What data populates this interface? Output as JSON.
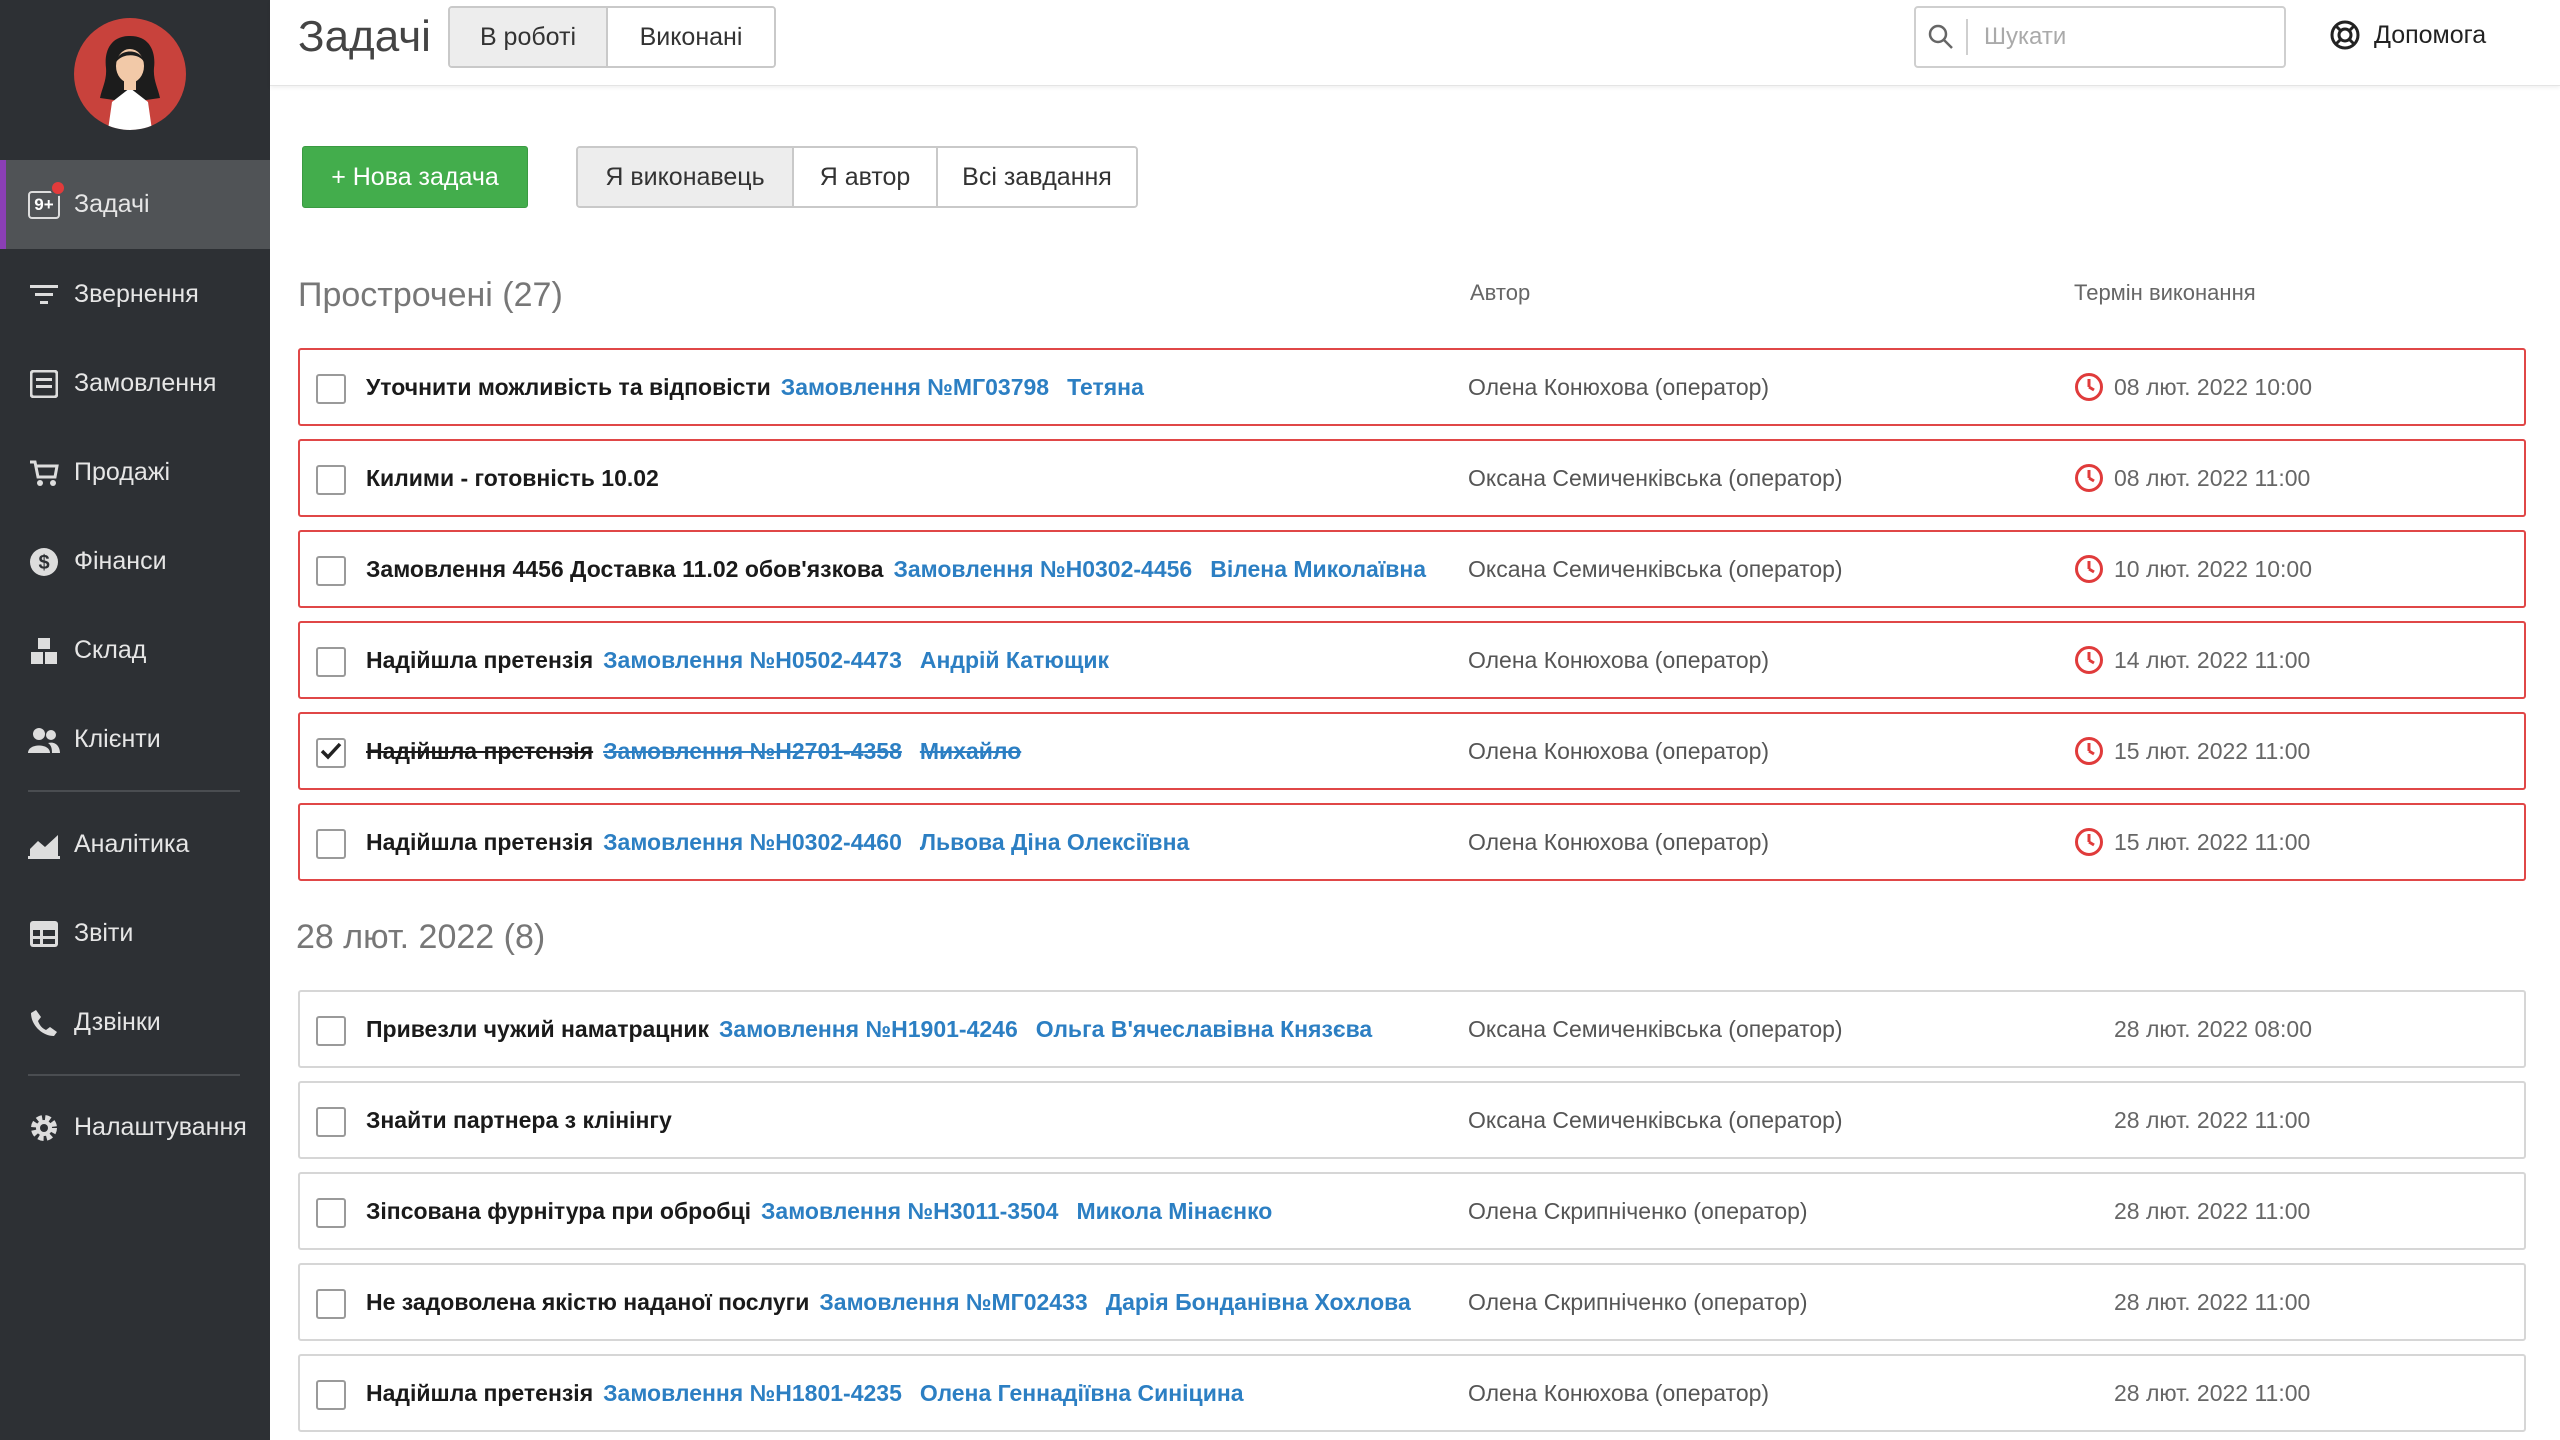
{
  "sidebar": {
    "items": [
      {
        "label": "Задачі",
        "icon": "tasks-badge-icon",
        "badge": "9+"
      },
      {
        "label": "Звернення",
        "icon": "filter-icon"
      },
      {
        "label": "Замовлення",
        "icon": "order-list-icon"
      },
      {
        "label": "Продажі",
        "icon": "cart-icon"
      },
      {
        "label": "Фінанси",
        "icon": "dollar-circle-icon"
      },
      {
        "label": "Склад",
        "icon": "boxes-icon"
      },
      {
        "label": "Клієнти",
        "icon": "users-icon"
      },
      {
        "label": "Аналітика",
        "icon": "chart-area-icon"
      },
      {
        "label": "Звіти",
        "icon": "table-icon"
      },
      {
        "label": "Дзвінки",
        "icon": "phone-icon"
      },
      {
        "label": "Налаштування",
        "icon": "gear-icon"
      }
    ]
  },
  "header": {
    "title": "Задачі",
    "tabs": [
      "В роботі",
      "Виконані"
    ],
    "search_placeholder": "Шукати",
    "help_label": "Допомога"
  },
  "toolbar": {
    "new_task_label": "+ Нова задача",
    "filters": [
      "Я виконавець",
      "Я автор",
      "Всі завдання"
    ]
  },
  "columns": {
    "author": "Автор",
    "due": "Термін виконання"
  },
  "overdue": {
    "title": "Прострочені (27)",
    "tasks": [
      {
        "title": "Уточнити можливість та відповісти",
        "order": "Замовлення №МГ03798",
        "client": "Тетяна",
        "author": "Олена Конюхова (оператор)",
        "due": "08 лют. 2022 10:00",
        "done": false
      },
      {
        "title": "Килими - готовність 10.02",
        "order": "",
        "client": "",
        "author": "Оксана Семиченківська (оператор)",
        "due": "08 лют. 2022 11:00",
        "done": false
      },
      {
        "title": "Замовлення 4456 Доставка 11.02 обов'язкова",
        "order": "Замовлення №Н0302-4456",
        "client": "Вілена Миколаївна",
        "author": "Оксана Семиченківська (оператор)",
        "due": "10 лют. 2022 10:00",
        "done": false
      },
      {
        "title": "Надійшла претензія",
        "order": "Замовлення №Н0502-4473",
        "client": "Андрій Катющик",
        "author": "Олена Конюхова (оператор)",
        "due": "14 лют. 2022 11:00",
        "done": false
      },
      {
        "title": "Надійшла претензія",
        "order": "Замовлення №Н2701-4358",
        "client": "Михайло",
        "author": "Олена Конюхова (оператор)",
        "due": "15 лют. 2022 11:00",
        "done": true
      },
      {
        "title": "Надійшла претензія",
        "order": "Замовлення №Н0302-4460",
        "client": "Львова Діна Олексіївна",
        "author": "Олена Конюхова (оператор)",
        "due": "15 лют. 2022 11:00",
        "done": false
      }
    ]
  },
  "date_group": {
    "title": "28 лют. 2022 (8)",
    "tasks": [
      {
        "title": "Привезли чужий наматрацник",
        "order": "Замовлення №Н1901-4246",
        "client": "Ольга В'ячеславівна Князєва",
        "author": "Оксана Семиченківська (оператор)",
        "due": "28 лют. 2022 08:00",
        "done": false
      },
      {
        "title": "Знайти партнера з клінінгу",
        "order": "",
        "client": "",
        "author": "Оксана Семиченківська (оператор)",
        "due": "28 лют. 2022 11:00",
        "done": false
      },
      {
        "title": "Зіпсована фурнітура при обробці",
        "order": "Замовлення №Н3011-3504",
        "client": "Микола Мінаєнко",
        "author": "Олена Скрипніченко (оператор)",
        "due": "28 лют. 2022 11:00",
        "done": false
      },
      {
        "title": "Не задоволена якістю наданої послуги",
        "order": "Замовлення №МГ02433",
        "client": "Дарія Бонданівна Хохлова",
        "author": "Олена Скрипніченко (оператор)",
        "due": "28 лют. 2022 11:00",
        "done": false
      },
      {
        "title": "Надійшла претензія",
        "order": "Замовлення №Н1801-4235",
        "client": "Олена Геннадіївна Синіцина",
        "author": "Олена Конюхова (оператор)",
        "due": "28 лют. 2022 11:00",
        "done": false
      }
    ]
  },
  "colors": {
    "sidebar_bg": "#2d3034",
    "active_accent": "#8b3fb5",
    "primary_button": "#43ad4c",
    "link": "#2c7fc3",
    "overdue_border": "#e04747"
  }
}
